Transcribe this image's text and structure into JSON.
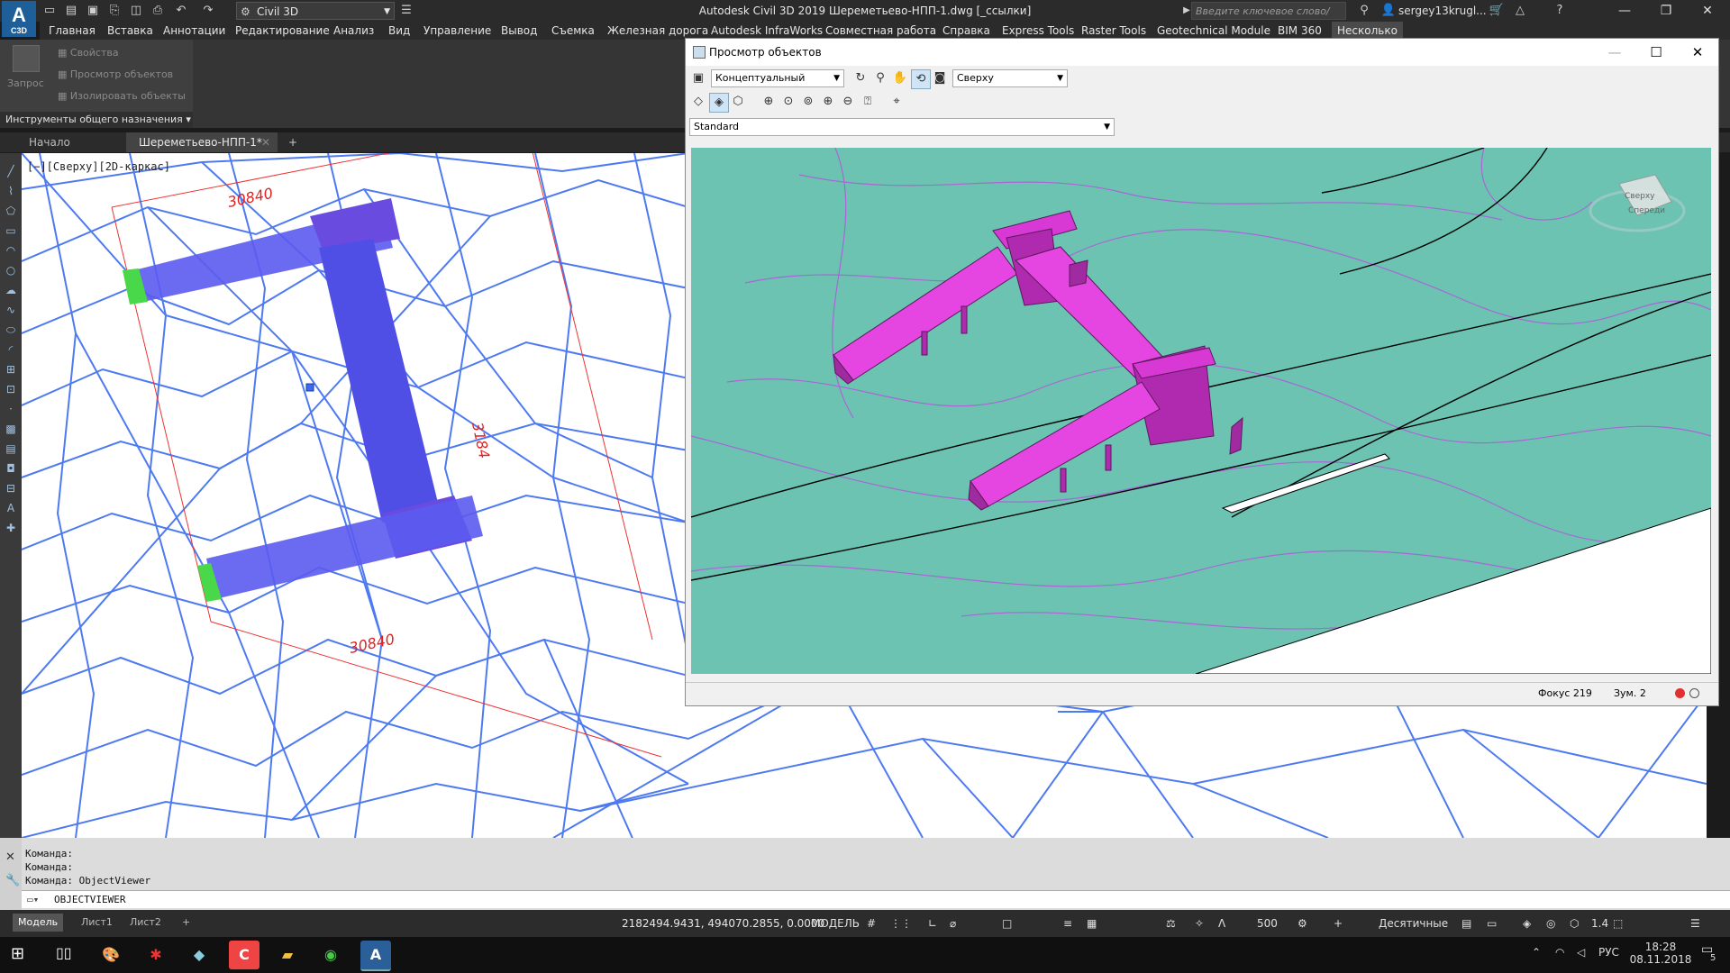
{
  "app": {
    "logo_text": "A",
    "logo_sub": "C3D",
    "workspace": "Civil 3D",
    "window_title": "Autodesk Civil 3D 2019    Шереметьево-НПП-1.dwg [_ссылки]",
    "search_placeholder": "Введите ключевое слово/фразу",
    "user": "sergey13krugl..."
  },
  "menu": [
    "Главная",
    "Вставка",
    "Аннотации",
    "Редактирование",
    "Анализ",
    "Вид",
    "Управление",
    "Вывод",
    "Съемка",
    "Железная дорога",
    "Autodesk InfraWorks",
    "Совместная работа",
    "Справка",
    "Express Tools",
    "Raster Tools",
    "Geotechnical Module",
    "BIM 360",
    "Несколько"
  ],
  "ribbon": {
    "big_button": "Запрос",
    "items": [
      "Свойства",
      "Просмотр объектов",
      "Изолировать объекты"
    ],
    "panel_title": "Инструменты общего назначения"
  },
  "doc_tabs": [
    "Начало",
    "Шереметьево-НПП-1*"
  ],
  "viewport_label": "[−][Сверху][2D-каркас]",
  "dimensions": [
    "30840",
    "3184",
    "30840"
  ],
  "object_viewer": {
    "title": "Просмотр объектов",
    "visual_style": "Концептуальный",
    "view": "Сверху",
    "standard": "Standard",
    "viewcube_top": "Сверху",
    "viewcube_front": "Спереди",
    "focus": "Фокус 219",
    "zoom": "Зум. 2"
  },
  "command": {
    "history": [
      "Команда:",
      "Команда:",
      "Команда: ObjectViewer"
    ],
    "current": "OBJECTVIEWER"
  },
  "layout_tabs": [
    "Модель",
    "Лист1",
    "Лист2"
  ],
  "status": {
    "coords": "2182494.9431, 494070.2855, 0.0000",
    "model": "МОДЕЛЬ",
    "scale": "500",
    "units": "Десятичные",
    "version": "1.4"
  },
  "taskbar": {
    "lang": "РУС",
    "time": "18:28",
    "date": "08.11.2018",
    "notif": "5"
  },
  "colors": {
    "terrain": "#6cc3b2",
    "bridge": "#e03ad6",
    "tin": "#3b6cf0"
  }
}
